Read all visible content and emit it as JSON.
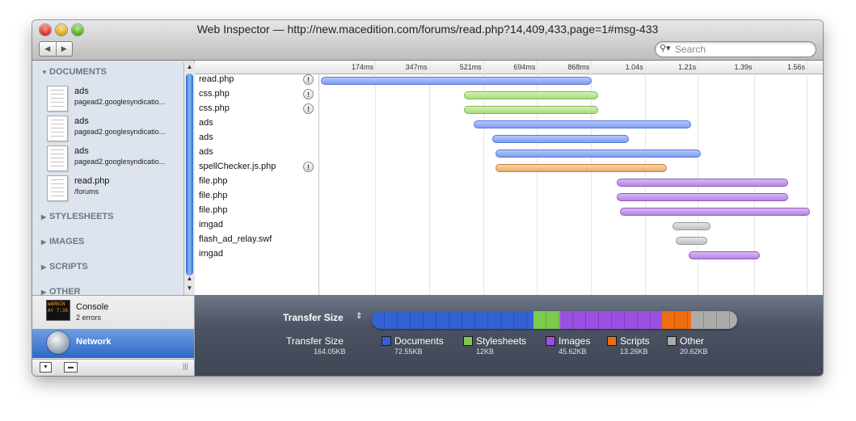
{
  "window": {
    "title": "Web Inspector — http://new.macedition.com/forums/read.php?14,409,433,page=1#msg-433"
  },
  "toolbar": {
    "back_glyph": "◀",
    "forward_glyph": "▶"
  },
  "search": {
    "placeholder": "Search",
    "icon": "magnifier-icon"
  },
  "sidebar": {
    "sections": [
      {
        "label": "DOCUMENTS",
        "expanded": true
      },
      {
        "label": "STYLESHEETS",
        "expanded": false
      },
      {
        "label": "IMAGES",
        "expanded": false
      },
      {
        "label": "SCRIPTS",
        "expanded": false
      },
      {
        "label": "OTHER",
        "expanded": false
      }
    ],
    "documents": [
      {
        "name": "ads",
        "subtitle": "pagead2.googlesyndicatio..."
      },
      {
        "name": "ads",
        "subtitle": "pagead2.googlesyndicatio..."
      },
      {
        "name": "ads",
        "subtitle": "pagead2.googlesyndicatio..."
      },
      {
        "name": "read.php",
        "subtitle": "/forums"
      }
    ],
    "console": {
      "label": "Console",
      "errors": "2 errors",
      "icon_text": "WARNIN\nAY 7:36"
    },
    "network": {
      "label": "Network"
    }
  },
  "timeline": {
    "ticks": [
      "174ms",
      "347ms",
      "521ms",
      "694ms",
      "868ms",
      "1.04s",
      "1.21s",
      "1.39s",
      "1.56s"
    ],
    "tick_seconds": [
      0.174,
      0.347,
      0.521,
      0.694,
      0.868,
      1.04,
      1.21,
      1.39,
      1.56
    ],
    "resources": [
      {
        "name": "read.php",
        "warning": true,
        "type": "doc",
        "start_s": 0.0,
        "end_s": 0.87
      },
      {
        "name": "css.php",
        "warning": true,
        "type": "css",
        "start_s": 0.46,
        "end_s": 0.89
      },
      {
        "name": "css.php",
        "warning": true,
        "type": "css",
        "start_s": 0.46,
        "end_s": 0.89
      },
      {
        "name": "ads",
        "warning": false,
        "type": "doc",
        "start_s": 0.49,
        "end_s": 1.19
      },
      {
        "name": "ads",
        "warning": false,
        "type": "doc",
        "start_s": 0.55,
        "end_s": 0.99
      },
      {
        "name": "ads",
        "warning": false,
        "type": "doc",
        "start_s": 0.56,
        "end_s": 1.22
      },
      {
        "name": "spellChecker.js.php",
        "warning": true,
        "type": "script",
        "start_s": 0.56,
        "end_s": 1.11
      },
      {
        "name": "file.php",
        "warning": false,
        "type": "img",
        "start_s": 0.95,
        "end_s": 1.5
      },
      {
        "name": "file.php",
        "warning": false,
        "type": "img",
        "start_s": 0.95,
        "end_s": 1.5
      },
      {
        "name": "file.php",
        "warning": false,
        "type": "img",
        "start_s": 0.96,
        "end_s": 1.57
      },
      {
        "name": "imgad",
        "warning": false,
        "type": "other",
        "start_s": 1.13,
        "end_s": 1.25
      },
      {
        "name": "flash_ad_relay.swf",
        "warning": false,
        "type": "other",
        "start_s": 1.14,
        "end_s": 1.24
      },
      {
        "name": "imgad",
        "warning": false,
        "type": "img",
        "start_s": 1.18,
        "end_s": 1.41
      }
    ]
  },
  "summary": {
    "selector_label": "Transfer Size",
    "selector_caret": "⇕",
    "total_label": "Transfer Size",
    "total_value": "164.05KB",
    "categories": [
      {
        "label": "Documents",
        "value": "72.55KB",
        "kb": 72.55,
        "color": "#3462d3",
        "type": "doc"
      },
      {
        "label": "Stylesheets",
        "value": "12KB",
        "kb": 12,
        "color": "#7ccb4e",
        "type": "css"
      },
      {
        "label": "Images",
        "value": "45.62KB",
        "kb": 45.62,
        "color": "#9a4fe0",
        "type": "img"
      },
      {
        "label": "Scripts",
        "value": "13.26KB",
        "kb": 13.26,
        "color": "#ee6e12",
        "type": "script"
      },
      {
        "label": "Other",
        "value": "20.62KB",
        "kb": 20.62,
        "color": "#ababab",
        "type": "other"
      }
    ]
  }
}
